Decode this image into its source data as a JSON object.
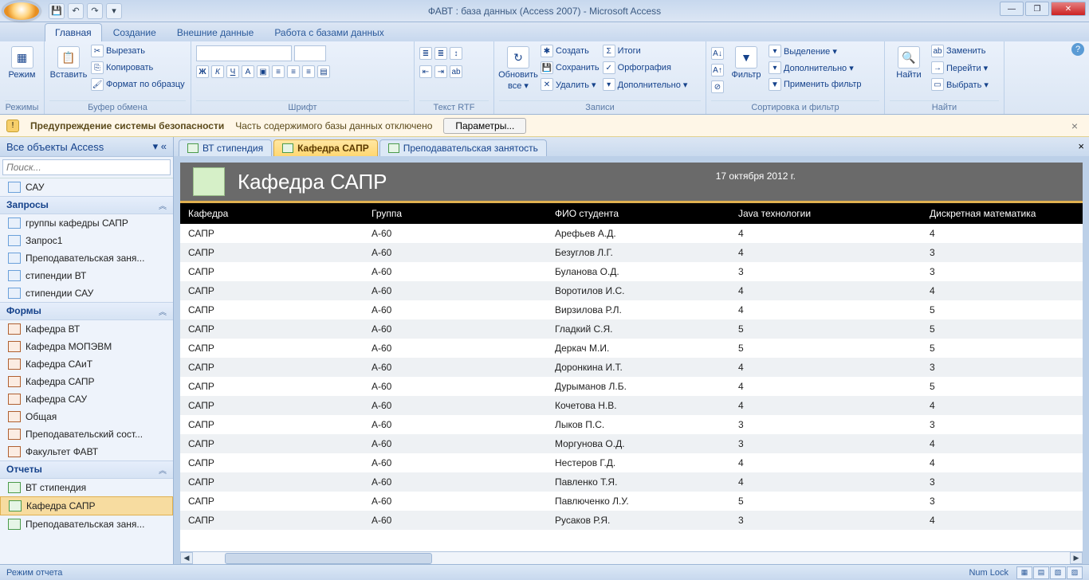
{
  "titlebar": {
    "title": "ФАВТ : база данных (Access 2007) - Microsoft Access"
  },
  "ribbon_tabs": [
    "Главная",
    "Создание",
    "Внешние данные",
    "Работа с базами данных"
  ],
  "ribbon": {
    "modes": {
      "label": "Режимы",
      "btn": "Режим"
    },
    "clipboard": {
      "label": "Буфер обмена",
      "paste": "Вставить",
      "cut": "Вырезать",
      "copy": "Копировать",
      "format": "Формат по образцу"
    },
    "font": {
      "label": "Шрифт"
    },
    "rtf": {
      "label": "Текст RTF"
    },
    "records": {
      "label": "Записи",
      "refresh_top": "Обновить",
      "refresh_bot": "все ▾",
      "new": "Создать",
      "save": "Сохранить",
      "delete": "Удалить ▾",
      "totals": "Итоги",
      "spelling": "Орфография",
      "more": "Дополнительно ▾"
    },
    "sort": {
      "label": "Сортировка и фильтр",
      "filter": "Фильтр",
      "selection": "Выделение ▾",
      "advanced": "Дополнительно ▾",
      "toggle": "Применить фильтр"
    },
    "find": {
      "label": "Найти",
      "find": "Найти",
      "replace": "Заменить",
      "goto": "Перейти ▾",
      "select": "Выбрать ▾"
    }
  },
  "security": {
    "title": "Предупреждение системы безопасности",
    "msg": "Часть содержимого базы данных отключено",
    "btn": "Параметры..."
  },
  "nav": {
    "header": "Все объекты Access",
    "search_placeholder": "Поиск...",
    "groups": {
      "tables": {
        "label": "",
        "items": [
          {
            "label": "САУ",
            "type": "tbl"
          }
        ]
      },
      "queries": {
        "label": "Запросы",
        "items": [
          {
            "label": "группы кафедры САПР",
            "type": "qry"
          },
          {
            "label": "Запрос1",
            "type": "qry"
          },
          {
            "label": "Преподавательская заня...",
            "type": "qry"
          },
          {
            "label": "стипендии ВТ",
            "type": "qry"
          },
          {
            "label": "стипендии САУ",
            "type": "qry"
          }
        ]
      },
      "forms": {
        "label": "Формы",
        "items": [
          {
            "label": "Кафедра ВТ",
            "type": "frm"
          },
          {
            "label": "Кафедра МОПЭВМ",
            "type": "frm"
          },
          {
            "label": "Кафедра САиТ",
            "type": "frm"
          },
          {
            "label": "Кафедра САПР",
            "type": "frm"
          },
          {
            "label": "Кафедра САУ",
            "type": "frm"
          },
          {
            "label": "Общая",
            "type": "frm"
          },
          {
            "label": "Преподавательский сост...",
            "type": "frm"
          },
          {
            "label": "Факультет ФАВТ",
            "type": "frm"
          }
        ]
      },
      "reports": {
        "label": "Отчеты",
        "items": [
          {
            "label": "ВТ стипендия",
            "type": "rpt"
          },
          {
            "label": "Кафедра САПР",
            "type": "rpt",
            "selected": true
          },
          {
            "label": "Преподавательская заня...",
            "type": "rpt"
          }
        ]
      }
    }
  },
  "doc_tabs": [
    {
      "label": "ВТ стипендия"
    },
    {
      "label": "Кафедра САПР",
      "active": true
    },
    {
      "label": "Преподавательская занятость"
    }
  ],
  "report": {
    "title": "Кафедра САПР",
    "date": "17 октября 2012 г.",
    "columns": [
      "Кафедра",
      "Группа",
      "ФИО студента",
      "Java технологии",
      "Дискретная математика"
    ],
    "rows": [
      [
        "САПР",
        "А-60",
        "Арефьев А.Д.",
        "4",
        "4"
      ],
      [
        "САПР",
        "А-60",
        "Безуглов Л.Г.",
        "4",
        "3"
      ],
      [
        "САПР",
        "А-60",
        "Буланова О.Д.",
        "3",
        "3"
      ],
      [
        "САПР",
        "А-60",
        "Воротилов И.С.",
        "4",
        "4"
      ],
      [
        "САПР",
        "А-60",
        "Вирзилова Р.Л.",
        "4",
        "5"
      ],
      [
        "САПР",
        "А-60",
        "Гладкий С.Я.",
        "5",
        "5"
      ],
      [
        "САПР",
        "А-60",
        "Деркач М.И.",
        "5",
        "5"
      ],
      [
        "САПР",
        "А-60",
        "Доронкина И.Т.",
        "4",
        "3"
      ],
      [
        "САПР",
        "А-60",
        "Дурыманов Л.Б.",
        "4",
        "5"
      ],
      [
        "САПР",
        "А-60",
        "Кочетова Н.В.",
        "4",
        "4"
      ],
      [
        "САПР",
        "А-60",
        "Лыков П.С.",
        "3",
        "3"
      ],
      [
        "САПР",
        "А-60",
        "Моргунова О.Д.",
        "3",
        "4"
      ],
      [
        "САПР",
        "А-60",
        "Нестеров Г.Д.",
        "4",
        "4"
      ],
      [
        "САПР",
        "А-60",
        "Павленко Т.Я.",
        "4",
        "3"
      ],
      [
        "САПР",
        "А-60",
        "Павлюченко Л.У.",
        "5",
        "3"
      ],
      [
        "САПР",
        "А-60",
        "Русаков Р.Я.",
        "3",
        "4"
      ]
    ]
  },
  "statusbar": {
    "mode": "Режим отчета",
    "numlock": "Num Lock"
  }
}
